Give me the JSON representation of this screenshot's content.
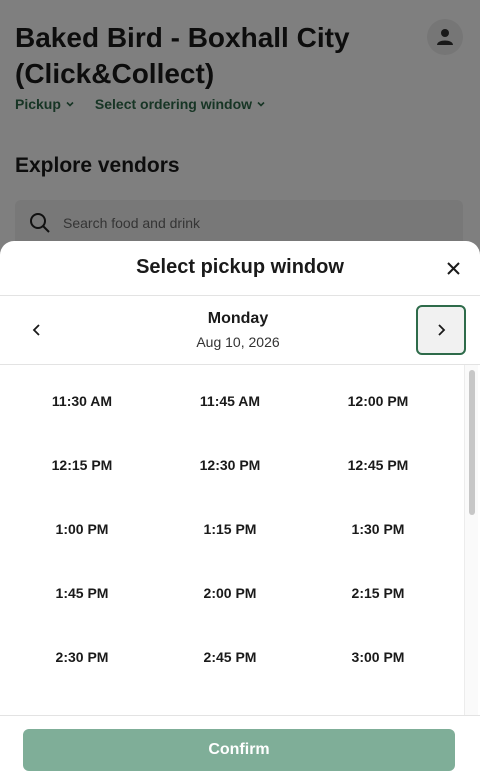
{
  "page": {
    "title": "Baked Bird - Boxhall City (Click&Collect)",
    "filters": [
      {
        "label": "Pickup"
      },
      {
        "label": "Select ordering window"
      }
    ],
    "section_heading": "Explore vendors",
    "search": {
      "placeholder": "Search food and drink",
      "value": ""
    }
  },
  "modal": {
    "title": "Select pickup window",
    "day": "Monday",
    "date": "Aug 10, 2026",
    "slots": [
      "11:30 AM",
      "11:45 AM",
      "12:00 PM",
      "12:15 PM",
      "12:30 PM",
      "12:45 PM",
      "1:00 PM",
      "1:15 PM",
      "1:30 PM",
      "1:45 PM",
      "2:00 PM",
      "2:15 PM",
      "2:30 PM",
      "2:45 PM",
      "3:00 PM"
    ],
    "confirm_label": "Confirm"
  },
  "colors": {
    "accent": "#2e6b4a",
    "confirm_disabled": "#7fae98"
  }
}
